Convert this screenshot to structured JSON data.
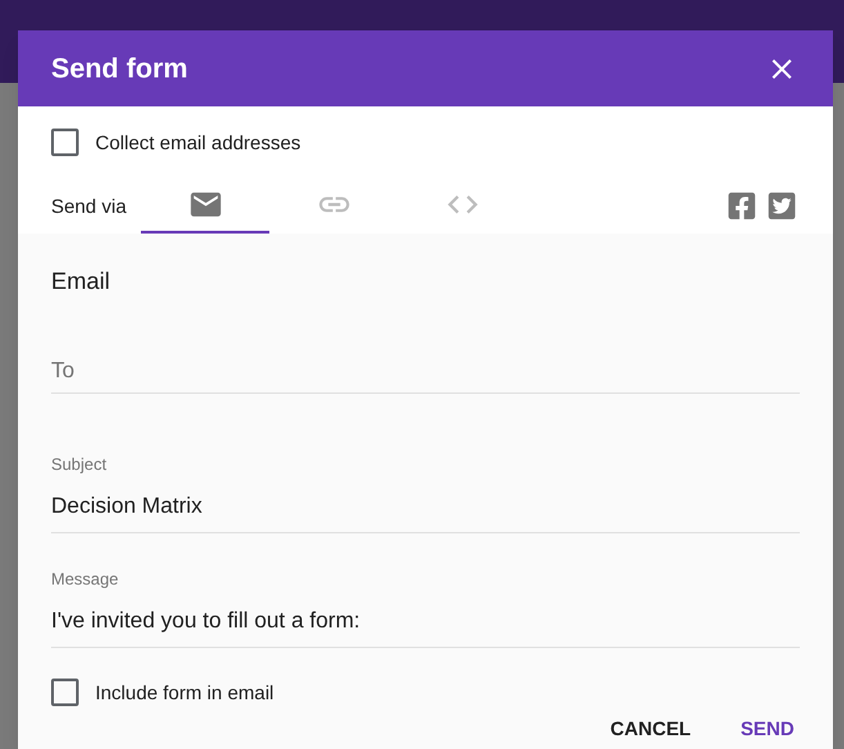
{
  "dialog": {
    "title": "Send form",
    "collect_email": {
      "label": "Collect email addresses",
      "checked": false
    },
    "send_via": {
      "label": "Send via",
      "tabs": [
        {
          "kind": "email",
          "selected": true
        },
        {
          "kind": "link",
          "selected": false
        },
        {
          "kind": "embed",
          "selected": false
        }
      ]
    },
    "section_title": "Email",
    "fields": [
      {
        "kind": "plain",
        "placeholder": "To"
      },
      {
        "kind": "labeled",
        "label": "Subject",
        "value": "Decision Matrix"
      },
      {
        "kind": "labeled",
        "label": "Message",
        "value": "I've invited you to fill out a form:"
      }
    ],
    "include_form": {
      "label": "Include form in email",
      "checked": false
    },
    "buttons": [
      {
        "label": "CANCEL",
        "kind": "secondary"
      },
      {
        "label": "SEND",
        "kind": "primary"
      }
    ]
  }
}
